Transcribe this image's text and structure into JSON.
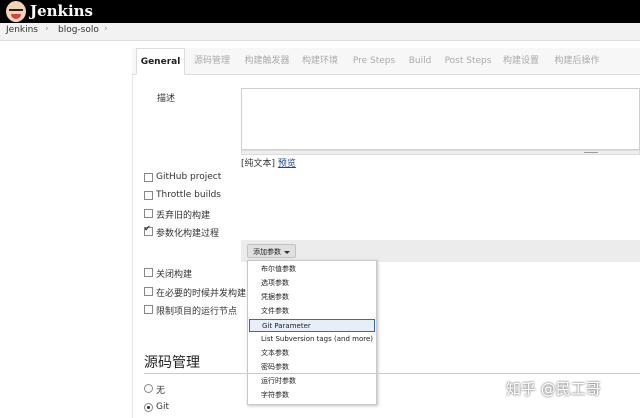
{
  "app": {
    "name": "Jenkins"
  },
  "breadcrumb": [
    "Jenkins",
    "blog-solo"
  ],
  "tabs": [
    "General",
    "源码管理",
    "构建触发器",
    "构建环境",
    "Pre Steps",
    "Build",
    "Post Steps",
    "构建设置",
    "构建后操作"
  ],
  "general": {
    "description_label": "描述",
    "plain_text": "[纯文本]",
    "preview_link": "预览",
    "checkboxes": [
      {
        "label": "GitHub project",
        "checked": false
      },
      {
        "label": "Throttle builds",
        "checked": false
      },
      {
        "label": "丢弃旧的构建",
        "checked": false
      },
      {
        "label": "参数化构建过程",
        "checked": true
      },
      {
        "label": "关闭构建",
        "checked": false
      },
      {
        "label": "在必要的时候并发构建",
        "checked": false
      },
      {
        "label": "限制项目的运行节点",
        "checked": false
      }
    ],
    "add_param_button": "添加参数",
    "param_menu": [
      "布尔值参数",
      "选项参数",
      "凭据参数",
      "文件参数",
      "Git Parameter",
      "List Subversion tags (and more)",
      "文本参数",
      "密码参数",
      "运行时参数",
      "字符参数"
    ],
    "highlighted_param": "Git Parameter"
  },
  "scm": {
    "title": "源码管理",
    "options": [
      {
        "label": "无",
        "selected": false
      },
      {
        "label": "Git",
        "selected": true
      }
    ]
  },
  "watermark": "知乎 @民工哥"
}
